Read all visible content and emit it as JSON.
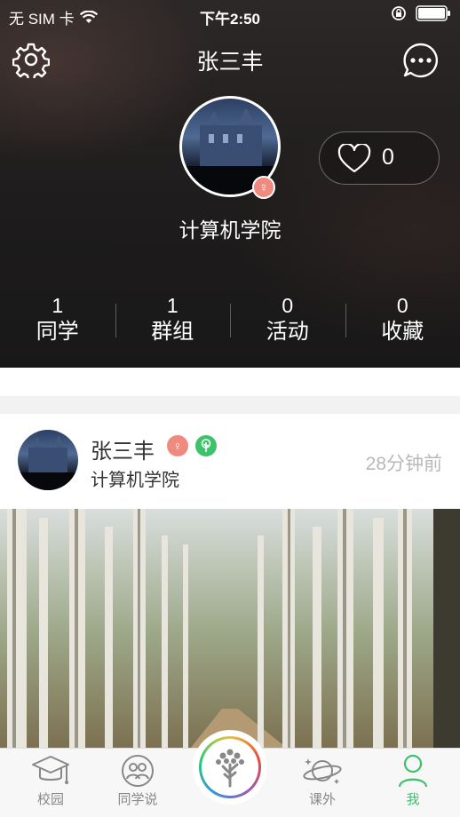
{
  "status_bar": {
    "carrier": "无 SIM 卡",
    "time": "下午2:50"
  },
  "header": {
    "title": "张三丰",
    "college": "计算机学院",
    "like_count": "0",
    "gender_symbol": "♀"
  },
  "stats": [
    {
      "value": "1",
      "label": "同学"
    },
    {
      "value": "1",
      "label": "群组"
    },
    {
      "value": "0",
      "label": "活动"
    },
    {
      "value": "0",
      "label": "收藏"
    }
  ],
  "post": {
    "author": "张三丰",
    "college": "计算机学院",
    "time": "28分钟前",
    "gender_symbol": "♀"
  },
  "tabbar": {
    "tabs": [
      {
        "label": "校园",
        "icon": "graduation-cap-icon"
      },
      {
        "label": "同学说",
        "icon": "people-icon"
      },
      {
        "label": "课外",
        "icon": "planet-icon"
      },
      {
        "label": "我",
        "icon": "person-icon"
      }
    ],
    "active_index": 3,
    "active_color": "#3cc36b"
  }
}
